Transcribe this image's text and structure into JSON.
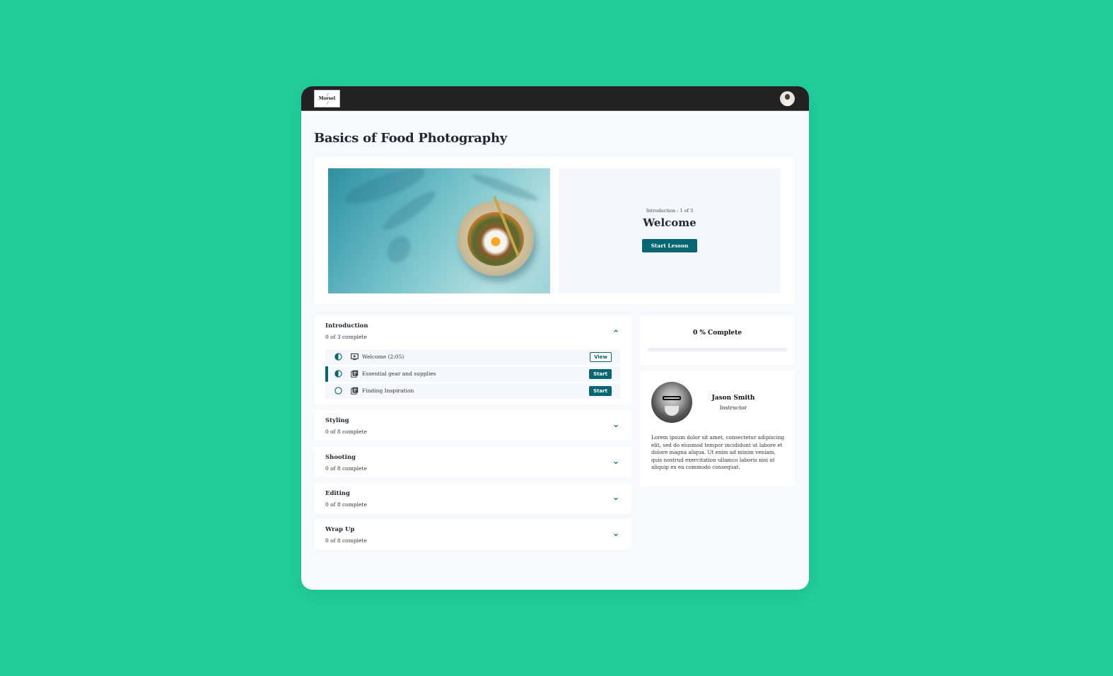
{
  "app": {
    "logo_text": "Morsel",
    "user_avatar": "user-avatar"
  },
  "course": {
    "title": "Basics of Food Photography"
  },
  "hero": {
    "image": "food-bowl-photo",
    "lesson_context": "Introduction : 1 of 3",
    "lesson_title": "Welcome",
    "start_button": "Start Lesson"
  },
  "modules": [
    {
      "title": "Introduction",
      "count": "0 of 3 complete",
      "expanded": true,
      "lessons": [
        {
          "label": "Welcome (2:05)",
          "status": "half-circle-icon",
          "type": "video-icon",
          "action": "View",
          "active": false
        },
        {
          "label": "Essential gear and supplies",
          "status": "half-circle-icon",
          "type": "reading-icon",
          "action": "Start",
          "active": true
        },
        {
          "label": "Finding Inspiration",
          "status": "empty-circle-icon",
          "type": "reading-icon",
          "action": "Start",
          "active": false
        }
      ]
    },
    {
      "title": "Styling",
      "count": "0 of 8 complete",
      "expanded": false
    },
    {
      "title": "Shooting",
      "count": "0 of 8 complete",
      "expanded": false
    },
    {
      "title": "Editing",
      "count": "0 of 8 complete",
      "expanded": false
    },
    {
      "title": "Wrap Up",
      "count": "0 of 8 complete",
      "expanded": false
    }
  ],
  "progress": {
    "label": "0 % Complete",
    "percent": 0
  },
  "instructor": {
    "name": "Jason Smith",
    "role": "Instructor",
    "bio": "Lorem ipsum dolor sit amet, consectetur adipiscing elit, sed do eiusmod tempor incididunt ut labore et dolore magna aliqua. Ut enim ad minim veniam, quis nostrud exercitation ullamco laboris nisi ut aliquip ex ea commodo consequat."
  },
  "colors": {
    "background": "#22cd9b",
    "accent": "#066672",
    "topbar": "#222222",
    "page": "#f8f9fd"
  }
}
